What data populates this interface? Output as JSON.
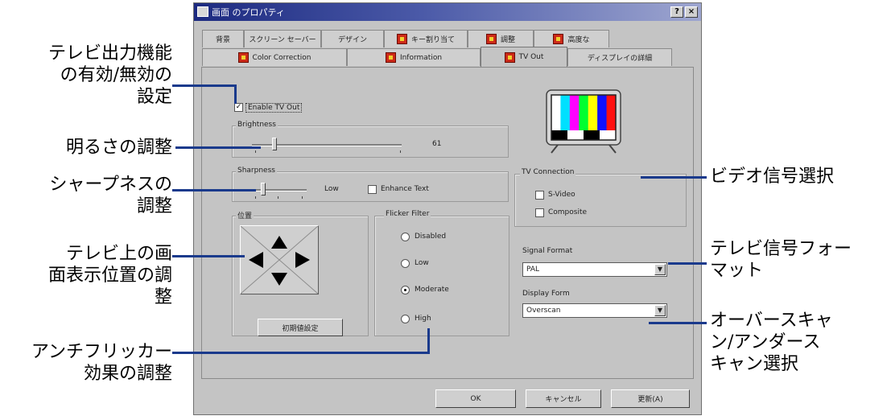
{
  "window": {
    "title": "画面 のプロパティ",
    "help_button": "?",
    "close_button": "×"
  },
  "tabs_back": [
    {
      "label": "背景",
      "icon": false
    },
    {
      "label": "スクリーン セーバー",
      "icon": false
    },
    {
      "label": "デザイン",
      "icon": false
    },
    {
      "label": "キー割り当て",
      "icon": true
    },
    {
      "label": "調整",
      "icon": true
    },
    {
      "label": "高度な",
      "icon": true
    }
  ],
  "tabs_front": [
    {
      "label": "Color Correction",
      "icon": true
    },
    {
      "label": "Information",
      "icon": true
    },
    {
      "label": "TV Out",
      "icon": true,
      "active": true
    },
    {
      "label": "ディスプレイの詳細",
      "icon": false
    }
  ],
  "tv_out": {
    "enable_label": "Enable TV Out",
    "enabled": true,
    "brightness_label": "Brightness",
    "brightness_value": "61",
    "sharpness_label": "Sharpness",
    "sharpness_value": "Low",
    "sharpness_level": 0.2,
    "brightness_level": 0.15,
    "enhance_text_label": "Enhance Text",
    "position_label": "位置",
    "reset_button": "初期値設定",
    "flicker_label": "Flicker Filter",
    "flicker_options": [
      "Disabled",
      "Low",
      "Moderate",
      "High"
    ],
    "flicker_selected": "Moderate",
    "connection_label": "TV Connection",
    "connection_options": [
      "S-Video",
      "Composite"
    ],
    "signal_format_label": "Signal Format",
    "signal_format_value": "PAL",
    "display_form_label": "Display Form",
    "display_form_value": "Overscan"
  },
  "buttons": {
    "ok": "OK",
    "cancel": "キャンセル",
    "apply": "更新(A)"
  },
  "tv_bars_colors": [
    "#ffffff",
    "#00e0ff",
    "#ff00ff",
    "#00ff30",
    "#ffff00",
    "#1010ff",
    "#ff1010"
  ],
  "callouts": {
    "tv_enable": [
      "テレビ出力機能",
      "の有効/無効の",
      "設定"
    ],
    "brightness": [
      "明るさの調整"
    ],
    "sharpness": [
      "シャープネスの",
      "調整"
    ],
    "position": [
      "テレビ上の画",
      "面表示位置の調",
      "整"
    ],
    "antiflicker": [
      "アンチフリッカー",
      "効果の調整"
    ],
    "video_signal": [
      "ビデオ信号選択"
    ],
    "tv_signal_format": [
      "テレビ信号フォー",
      "マット"
    ],
    "overscan": [
      "オーバースキャ",
      "ン/アンダース",
      "キャン選択"
    ]
  }
}
